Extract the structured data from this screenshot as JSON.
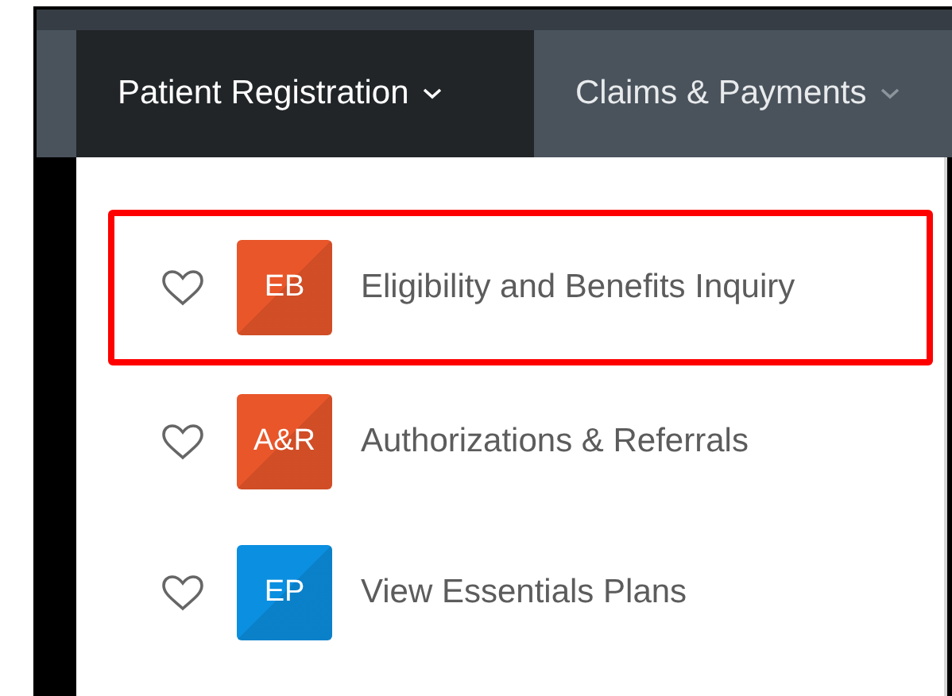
{
  "nav": {
    "tabs": [
      {
        "label": "Patient Registration",
        "selected": true
      },
      {
        "label": "Claims & Payments",
        "selected": false
      }
    ]
  },
  "menu": {
    "items": [
      {
        "badge": "EB",
        "label": "Eligibility and Benefits Inquiry",
        "color": "#e8562a",
        "favorite": false,
        "highlighted": true
      },
      {
        "badge": "A&R",
        "label": "Authorizations & Referrals",
        "color": "#e8562a",
        "favorite": false,
        "highlighted": false
      },
      {
        "badge": "EP",
        "label": "View Essentials Plans",
        "color": "#0b8fe0",
        "favorite": false,
        "highlighted": false
      }
    ]
  }
}
